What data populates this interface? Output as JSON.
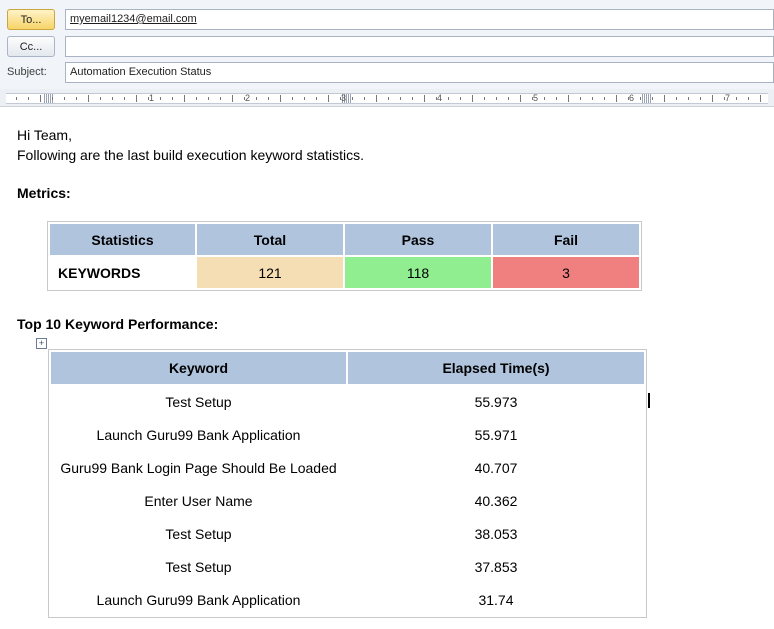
{
  "header": {
    "to_button": "To...",
    "cc_button": "Cc...",
    "subject_label": "Subject:",
    "to_value": "myemail1234@email.com",
    "cc_value": "",
    "subject_value": "Automation Execution Status"
  },
  "ruler": {
    "numbers": [
      "1",
      "2",
      "3",
      "4",
      "5",
      "6",
      "7"
    ]
  },
  "body": {
    "greeting": "Hi Team,",
    "intro": "Following are the last build execution keyword statistics.",
    "metrics_heading": "Metrics:",
    "metrics_table": {
      "headers": [
        "Statistics",
        "Total",
        "Pass",
        "Fail"
      ],
      "row_label": "KEYWORDS",
      "total": "121",
      "pass": "118",
      "fail": "3"
    },
    "perf_heading": "Top 10 Keyword Performance:",
    "perf_table": {
      "headers": [
        "Keyword",
        "Elapsed Time(s)"
      ],
      "rows": [
        {
          "keyword": "Test Setup",
          "time": "55.973"
        },
        {
          "keyword": "Launch Guru99 Bank Application",
          "time": "55.971"
        },
        {
          "keyword": "Guru99 Bank Login Page Should Be Loaded",
          "time": "40.707"
        },
        {
          "keyword": "Enter User Name",
          "time": "40.362"
        },
        {
          "keyword": "Test Setup",
          "time": "38.053"
        },
        {
          "keyword": "Test Setup",
          "time": "37.853"
        },
        {
          "keyword": "Launch Guru99 Bank Application",
          "time": "31.74"
        }
      ]
    }
  },
  "colors": {
    "table_header": "#b0c4de",
    "total_cell": "#f5deb3",
    "pass_cell": "#90ee90",
    "fail_cell": "#f08080"
  }
}
